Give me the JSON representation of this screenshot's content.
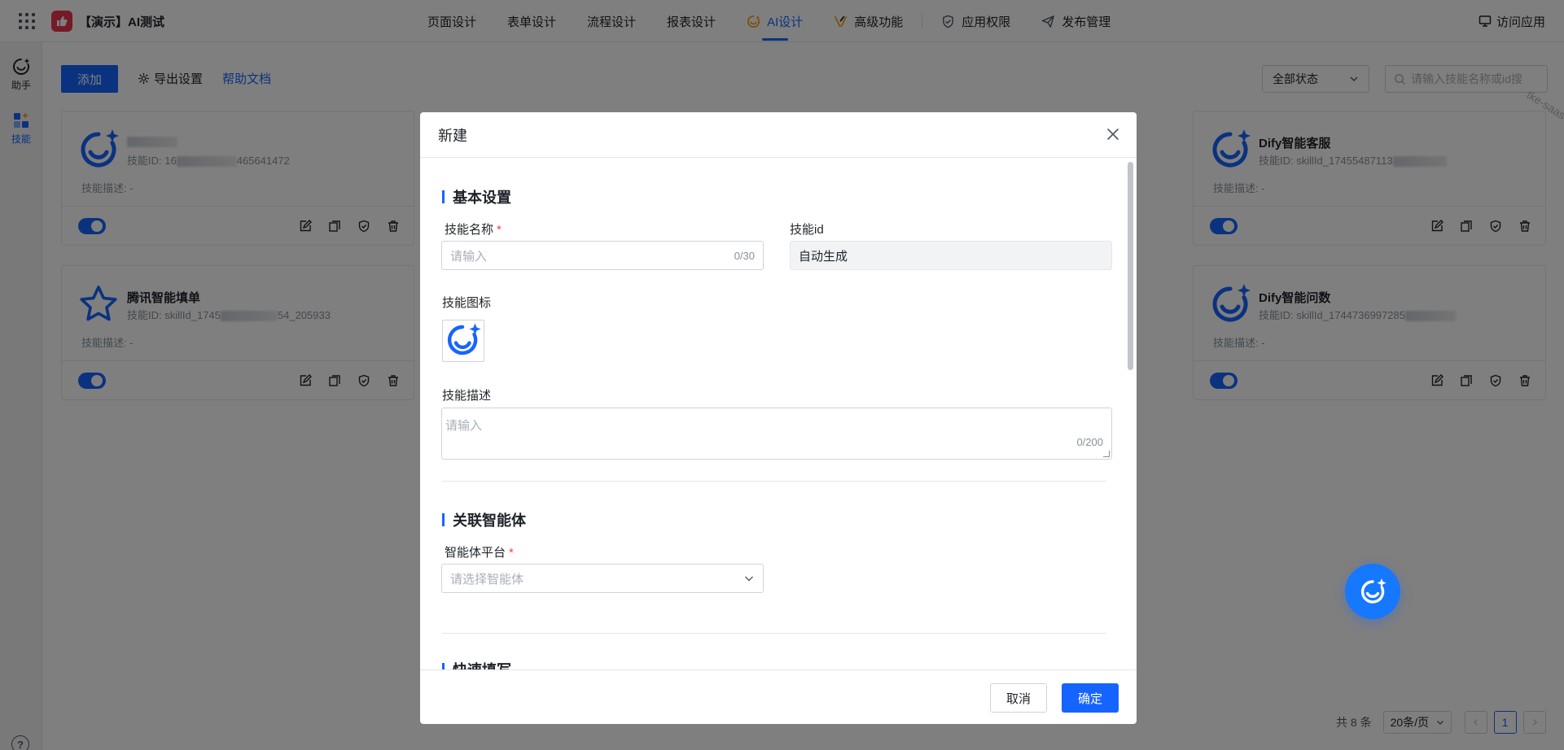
{
  "header": {
    "app_title": "【演示】AI测试",
    "nav": [
      {
        "label": "页面设计"
      },
      {
        "label": "表单设计"
      },
      {
        "label": "流程设计"
      },
      {
        "label": "报表设计"
      },
      {
        "label": "AI设计"
      },
      {
        "label": "高级功能"
      },
      {
        "label": "应用权限"
      },
      {
        "label": "发布管理"
      }
    ],
    "visit_label": "访问应用"
  },
  "rail": {
    "assistant_label": "助手",
    "skills_label": "技能",
    "help_glyph": "?"
  },
  "toolbar": {
    "add_label": "添加",
    "export_label": "导出设置",
    "help_label": "帮助文档",
    "status_value": "全部状态",
    "search_placeholder": "请输入技能名称或id搜",
    "watermark": "tke-saas-uat"
  },
  "cards": [
    {
      "title": "",
      "id_prefix": "技能ID: 16",
      "id_suffix": "465641472",
      "desc": "技能描述: -",
      "icon": "ai-smile-sparkle-icon"
    },
    {
      "title": "Dify智能客服",
      "id_prefix": "技能ID: skillId_17455487113",
      "id_suffix": "",
      "desc": "技能描述: -",
      "icon": "ai-smile-sparkle-icon"
    },
    {
      "title": "腾讯智能填单",
      "id_prefix": "技能ID: skillId_1745",
      "id_suffix": "54_205933",
      "desc": "技能描述: -",
      "icon": "star-icon"
    },
    {
      "title": "Dify智能问数",
      "id_prefix": "技能ID: skillId_1744736997285",
      "id_suffix": "",
      "desc": "技能描述: -",
      "icon": "ai-smile-sparkle-icon"
    }
  ],
  "pagination": {
    "total": "共 8 条",
    "page_size": "20条/页",
    "current_page": "1"
  },
  "modal": {
    "title": "新建",
    "section_basic": "基本设置",
    "name_label": "技能名称",
    "name_placeholder": "请输入",
    "name_count": "0/30",
    "id_label": "技能id",
    "id_value": "自动生成",
    "icon_label": "技能图标",
    "desc_label": "技能描述",
    "desc_placeholder": "请输入",
    "desc_count": "0/200",
    "section_agent": "关联智能体",
    "platform_label": "智能体平台",
    "platform_placeholder": "请选择智能体",
    "section_quick": "快速填写",
    "required_mark": "*",
    "cancel_label": "取消",
    "ok_label": "确定"
  },
  "colors": {
    "primary": "#1664ff",
    "logo": "#e8364f",
    "danger": "#f53f3f"
  }
}
